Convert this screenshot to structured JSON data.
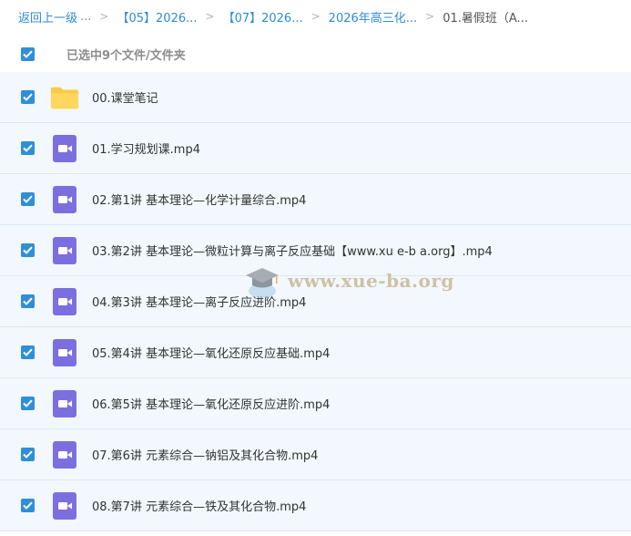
{
  "breadcrumb": {
    "back": "返回上一级",
    "dots": "...",
    "separator": ">",
    "items": [
      "【05】2026...",
      "【07】2026...",
      "2026年高三化..."
    ],
    "current": "01.暑假班（A..."
  },
  "selection": {
    "label": "已选中9个文件/文件夹",
    "all_checked": true
  },
  "files": [
    {
      "name": "00.课堂笔记",
      "type": "folder",
      "checked": true
    },
    {
      "name": "01.学习规划课.mp4",
      "type": "video",
      "checked": true
    },
    {
      "name": "02.第1讲 基本理论—化学计量综合.mp4",
      "type": "video",
      "checked": true
    },
    {
      "name": "03.第2讲 基本理论—微粒计算与离子反应基础【www.xu e-b a.org】.mp4",
      "type": "video",
      "checked": true
    },
    {
      "name": "04.第3讲 基本理论—离子反应进阶.mp4",
      "type": "video",
      "checked": true
    },
    {
      "name": "05.第4讲 基本理论—氧化还原反应基础.mp4",
      "type": "video",
      "checked": true
    },
    {
      "name": "06.第5讲 基本理论—氧化还原反应进阶.mp4",
      "type": "video",
      "checked": true
    },
    {
      "name": "07.第6讲 元素综合—钠铝及其化合物.mp4",
      "type": "video",
      "checked": true
    },
    {
      "name": "08.第7讲 元素综合—铁及其化合物.mp4",
      "type": "video",
      "checked": true
    }
  ],
  "icons": {
    "folder": "folder-icon",
    "video": "video-file-icon",
    "checkbox": "checkbox-checked-icon"
  },
  "colors": {
    "link": "#2e8bd6",
    "checkbox": "#2f8fd8",
    "row_bg": "#f2f8fd",
    "folder": "#fcca46",
    "video": "#7b6fe0"
  },
  "watermark": {
    "text": "www.xue-ba.org"
  }
}
